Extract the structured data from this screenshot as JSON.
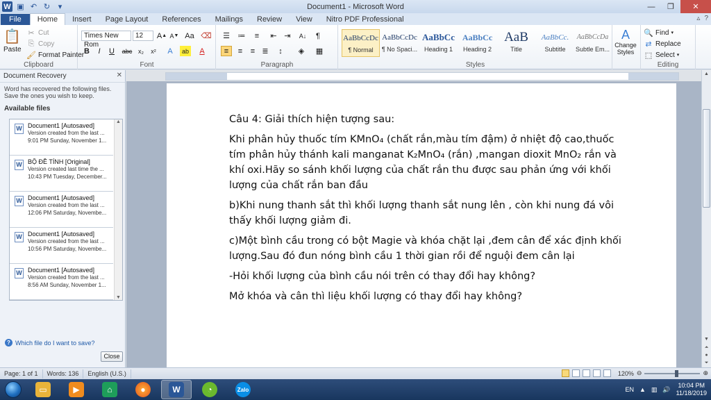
{
  "window": {
    "title": "Document1 - Microsoft Word"
  },
  "tabs": [
    "File",
    "Home",
    "Insert",
    "Page Layout",
    "References",
    "Mailings",
    "Review",
    "View",
    "Nitro PDF Professional"
  ],
  "ribbon": {
    "clipboard": {
      "paste": "Paste",
      "cut": "Cut",
      "copy": "Copy",
      "format_painter": "Format Painter",
      "label": "Clipboard"
    },
    "font": {
      "name": "Times New Rom",
      "size": "12",
      "label": "Font"
    },
    "paragraph": {
      "label": "Paragraph"
    },
    "styles": {
      "label": "Styles",
      "items": [
        {
          "sample": "AaBbCcDc",
          "name": "¶ Normal"
        },
        {
          "sample": "AaBbCcDc",
          "name": "¶ No Spaci..."
        },
        {
          "sample": "AaBbCc",
          "name": "Heading 1"
        },
        {
          "sample": "AaBbCc",
          "name": "Heading 2"
        },
        {
          "sample": "AaB",
          "name": "Title"
        },
        {
          "sample": "AaBbCc.",
          "name": "Subtitle"
        },
        {
          "sample": "AaBbCcDa",
          "name": "Subtle Em..."
        }
      ],
      "change_styles": "Change Styles"
    },
    "editing": {
      "find": "Find",
      "replace": "Replace",
      "select": "Select",
      "label": "Editing"
    }
  },
  "recovery": {
    "title": "Document Recovery",
    "message": "Word has recovered the following files.  Save the ones you wish to keep.",
    "available": "Available files",
    "files": [
      {
        "name": "Document1  [Autosaved]",
        "line1": "Version created from the last ...",
        "line2": "9:01 PM Sunday, November 1..."
      },
      {
        "name": "BỘ ĐỀ TÍNH  [Original]",
        "line1": "Version created last time the ...",
        "line2": "10:43 PM Tuesday, December..."
      },
      {
        "name": "Document1  [Autosaved]",
        "line1": "Version created from the last ...",
        "line2": "12:06 PM Saturday, Novembe..."
      },
      {
        "name": "Document1  [Autosaved]",
        "line1": "Version created from the last ...",
        "line2": "10:56 PM Saturday, Novembe..."
      },
      {
        "name": "Document1  [Autosaved]",
        "line1": "Version created from the last ...",
        "line2": "8:56 AM Sunday, November 1..."
      }
    ],
    "which_file": "Which file do I want to save?",
    "close": "Close"
  },
  "document": {
    "paragraphs": [
      "Câu 4: Giải thích hiện tượng sau:",
      "Khi phân hủy thuốc tím KMnO₄ (chất rắn,màu tím đậm) ở nhiệt độ cao,thuốc tím phân hủy thánh kali manganat K₂MnO₄ (rắn) ,mangan dioxit MnO₂ rắn và khí oxi.Hãy so sánh khối lượng của chất rắn thu được sau phản ứng với khối lượng của chất rắn ban đầu",
      "b)Khi nung thanh sắt thì khối lượng thanh sắt nung lên , còn khi nung đá vôi thấy khối lượng giảm đi.",
      "c)Một bình cầu trong có bột Magie và khóa chặt lại ,đem cân để xác định khối lượng.Sau đó đun nóng bình cầu 1 thời gian rồi để nguội đem cân lại",
      "-Hỏi khối lượng của bình cầu nói trên có thay đổi hay không?",
      "Mở khóa và cân thì liệu khối lượng có thay đổi hay không?"
    ]
  },
  "status": {
    "page": "Page: 1 of 1",
    "words": "Words: 136",
    "language": "English (U.S.)",
    "zoom": "120%"
  },
  "taskbar": {
    "lang": "EN",
    "time": "10:04 PM",
    "date": "11/18/2019",
    "zalo": "Zalo"
  }
}
